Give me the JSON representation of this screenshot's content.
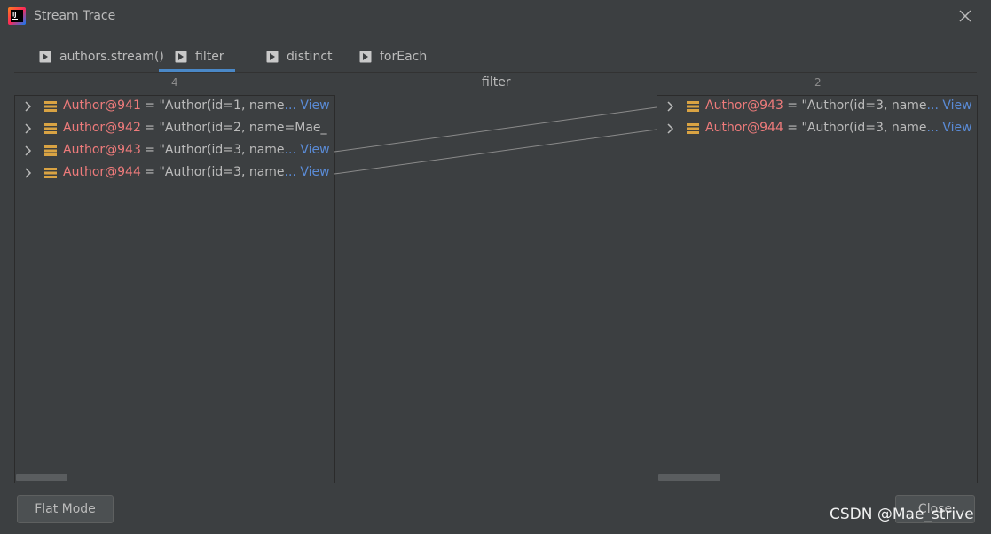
{
  "window": {
    "title": "Stream Trace"
  },
  "tabs": [
    {
      "label": "authors.stream()"
    },
    {
      "label": "filter"
    },
    {
      "label": "distinct"
    },
    {
      "label": "forEach"
    }
  ],
  "active_tab": "filter",
  "left_panel": {
    "count": "4",
    "rows": [
      {
        "object": "Author@941",
        "value": " = \"Author(id=1, name",
        "ellipsis": "... ",
        "view": "View"
      },
      {
        "object": "Author@942",
        "value": " = \"Author(id=2, name=Mae_",
        "ellipsis": "",
        "view": ""
      },
      {
        "object": "Author@943",
        "value": " = \"Author(id=3, name",
        "ellipsis": "... ",
        "view": "View"
      },
      {
        "object": "Author@944",
        "value": " = \"Author(id=3, name",
        "ellipsis": "... ",
        "view": "View"
      }
    ]
  },
  "middle": {
    "label": "filter"
  },
  "right_panel": {
    "count": "2",
    "rows": [
      {
        "object": "Author@943",
        "value": " = \"Author(id=3, name",
        "ellipsis": "... ",
        "view": "View"
      },
      {
        "object": "Author@944",
        "value": " = \"Author(id=3, name",
        "ellipsis": "... ",
        "view": "View"
      }
    ]
  },
  "buttons": {
    "flat_mode": "Flat Mode",
    "close": "Close"
  },
  "watermark": "CSDN @Mae_strive",
  "colors": {
    "accent": "#4a88c7",
    "object_name": "#ee7b7b",
    "link": "#5a8bd6",
    "background": "#3c3f41"
  },
  "icons": {
    "app": "intellij-idea-icon",
    "tab": "play-frame-icon",
    "row": "object-stack-icon",
    "expand": "chevron-right-icon",
    "close": "close-icon"
  }
}
